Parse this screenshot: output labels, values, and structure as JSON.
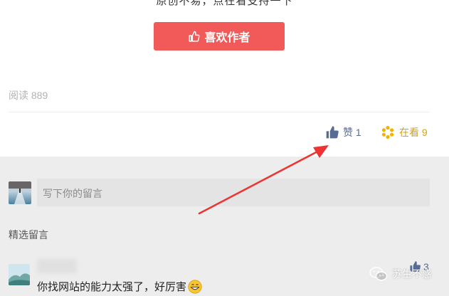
{
  "article": {
    "cut_text": "原创不易，点在看支持一下",
    "like_author_label": "喜欢作者",
    "read_label": "阅读 889",
    "zan_label": "赞 1",
    "zaikan_label": "在看 9"
  },
  "comment_input": {
    "placeholder": "写下你的留言"
  },
  "selected_comments": {
    "title": "精选留言",
    "items": [
      {
        "name": "",
        "likes": "3",
        "text": "你找网站的能力太强了，好厉害",
        "emoji": "grinning-face-emoji"
      }
    ]
  },
  "watermark": {
    "label": "苏生不惑",
    "icon": "wechat-icon"
  },
  "colors": {
    "like_button": "#f25a5a",
    "link_blue": "#576b95",
    "zaikan_gold": "#d3a11c",
    "annotation_arrow": "#ee3333",
    "page_bg": "#ededed"
  }
}
